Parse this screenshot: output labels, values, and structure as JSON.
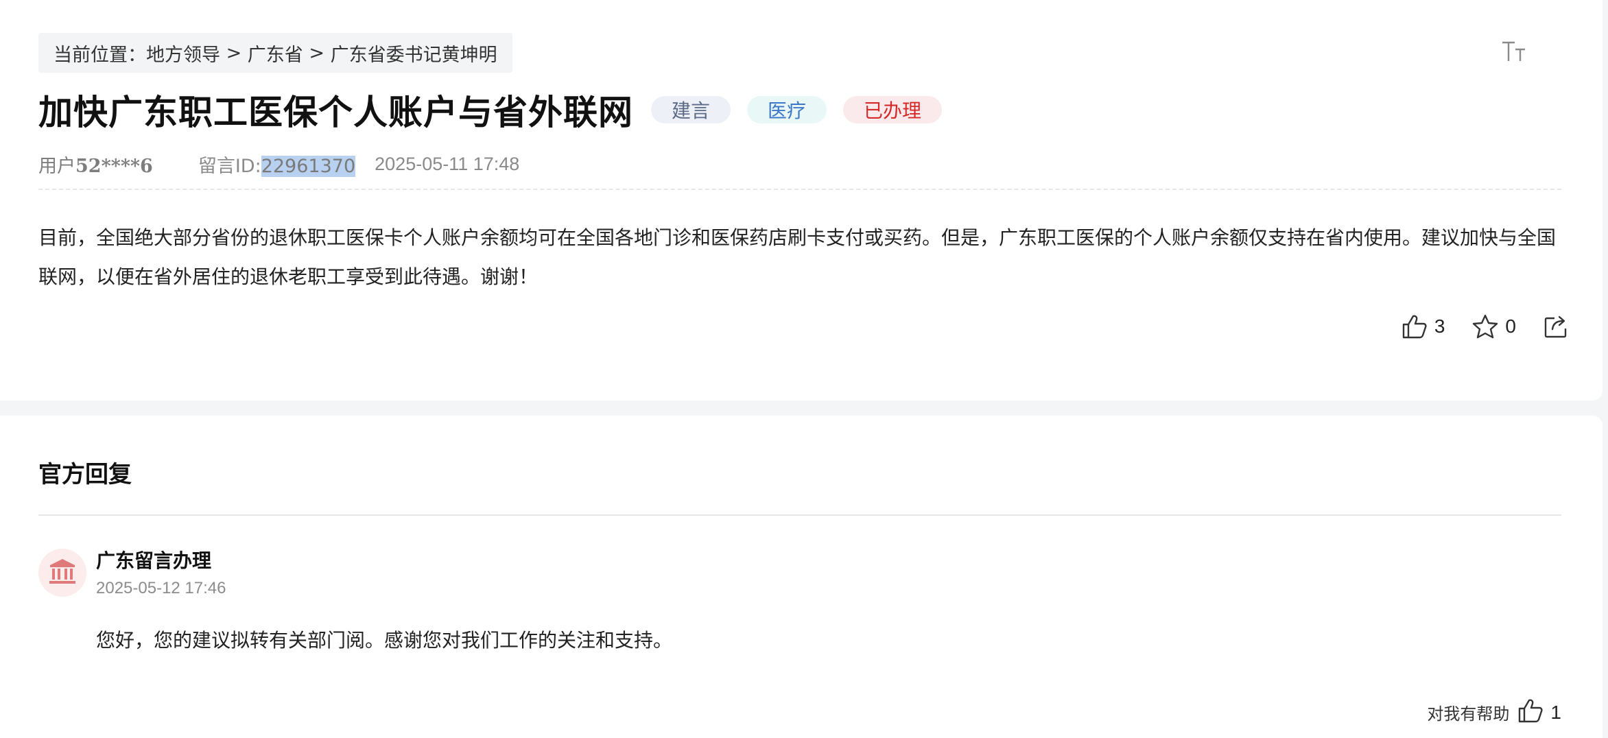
{
  "breadcrumb": {
    "prefix": "当前位置：",
    "items": [
      "地方领导",
      "广东省",
      "广东省委书记黄坤明"
    ],
    "separator": " > "
  },
  "post": {
    "title": "加快广东职工医保个人账户与省外联网",
    "tags": [
      "建言",
      "医疗",
      "已办理"
    ],
    "user_prefix": "用户",
    "user_id": "52****6",
    "message_id_label": "留言ID:",
    "message_id": "22961370",
    "date": "2025-05-11 17:48",
    "content": "目前，全国绝大部分省份的退休职工医保卡个人账户余额均可在全国各地门诊和医保药店刷卡支付或买药。但是，广东职工医保的个人账户余额仅支持在省内使用。建议加快与全国联网，以便在省外居住的退休老职工享受到此待遇。谢谢！",
    "like_count": "3",
    "favorite_count": "0"
  },
  "reply": {
    "section_title": "官方回复",
    "author": "广东留言办理",
    "date": "2025-05-12 17:46",
    "text": "您好，您的建议拟转有关部门阅。感谢您对我们工作的关注和支持。",
    "helpful_label": "对我有帮助",
    "helpful_count": "1"
  },
  "icons": {
    "font_size": "font-size-icon",
    "like": "thumbs-up-icon",
    "favorite": "star-icon",
    "share": "share-icon",
    "avatar": "institution-icon"
  },
  "colors": {
    "tag_suggestion": "#5b6a86",
    "tag_medical": "#3b78c9",
    "tag_done": "#d42a2a",
    "highlight": "#b8d1f0"
  }
}
